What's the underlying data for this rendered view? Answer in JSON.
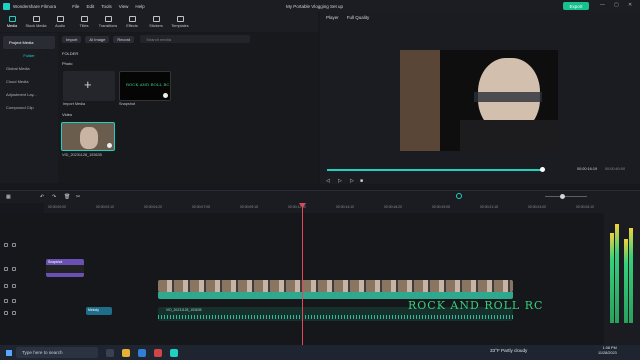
{
  "titlebar": {
    "app_name": "Wondershare Filmora",
    "menus": [
      "File",
      "Edit",
      "Tools",
      "View",
      "Help"
    ],
    "project_name": "My Portable Vlogging Set up",
    "export_label": "Export"
  },
  "toolbar": {
    "tabs": [
      {
        "label": "Media",
        "icon": "media-icon",
        "active": true
      },
      {
        "label": "Stock Media",
        "icon": "stock-media-icon",
        "active": false
      },
      {
        "label": "Audio",
        "icon": "audio-icon",
        "active": false
      },
      {
        "label": "Titles",
        "icon": "titles-icon",
        "active": false
      },
      {
        "label": "Transitions",
        "icon": "transitions-icon",
        "active": false
      },
      {
        "label": "Effects",
        "icon": "effects-icon",
        "active": false
      },
      {
        "label": "Stickers",
        "icon": "stickers-icon",
        "active": false
      },
      {
        "label": "Templates",
        "icon": "templates-icon",
        "active": false
      }
    ]
  },
  "sidebar": {
    "project_media": "Project Media",
    "folder": "Folder",
    "items": [
      "Global Media",
      "Cloud Media",
      "Adjustment Lay...",
      "Compound Clip"
    ]
  },
  "media": {
    "import_label": "Import",
    "ai_image_label": "AI Image",
    "record_label": "Record",
    "search_placeholder": "Search media",
    "folder_header": "FOLDER",
    "photo_section": "Photo",
    "video_section": "Video",
    "photo_items": [
      "Import Media",
      "Snapshot"
    ],
    "video_items": [
      "VID_20231128_153635"
    ]
  },
  "player": {
    "tab_label": "Player",
    "quality": "Full Quality",
    "current_time": "00:00:16:19",
    "total_time": "00:00:40:00",
    "progress": 0.91
  },
  "timeline": {
    "ruler_ticks": [
      "00:00:00:00",
      "00:00:01:05",
      "00:00:02:10",
      "00:00:03:15",
      "00:00:04:20",
      "00:00:06:00",
      "00:00:07:05",
      "00:00:08:10",
      "00:00:09:15",
      "00:00:10:20",
      "00:00:12:00",
      "00:00:13:05",
      "00:00:14:10",
      "00:00:15:15",
      "00:00:16:20",
      "00:00:18:00",
      "00:00:19:05",
      "00:00:20:10",
      "00:00:21:15",
      "00:00:22:20",
      "00:00:24:00",
      "00:00:25:05",
      "00:00:26:10",
      "00:00:27:15"
    ],
    "snapshot_clip": "Snapshot",
    "video_clip": "VID_20231128_153635",
    "audio_clip": "VID_20231128_153635",
    "music_clip": "Melody",
    "overlay_text": "ROCK AND ROLL RC",
    "meter_levels": [
      0.82,
      0.9,
      0.76,
      0.86
    ]
  },
  "taskbar": {
    "search_text": "Type here to search",
    "weather": "33°F  Partly cloudy",
    "time": "1:08 PM",
    "date": "11/28/2023"
  },
  "colors": {
    "accent": "#1fd1c1",
    "export": "#18c28e",
    "playhead": "#e0495a",
    "clip": "#2ea88f"
  }
}
